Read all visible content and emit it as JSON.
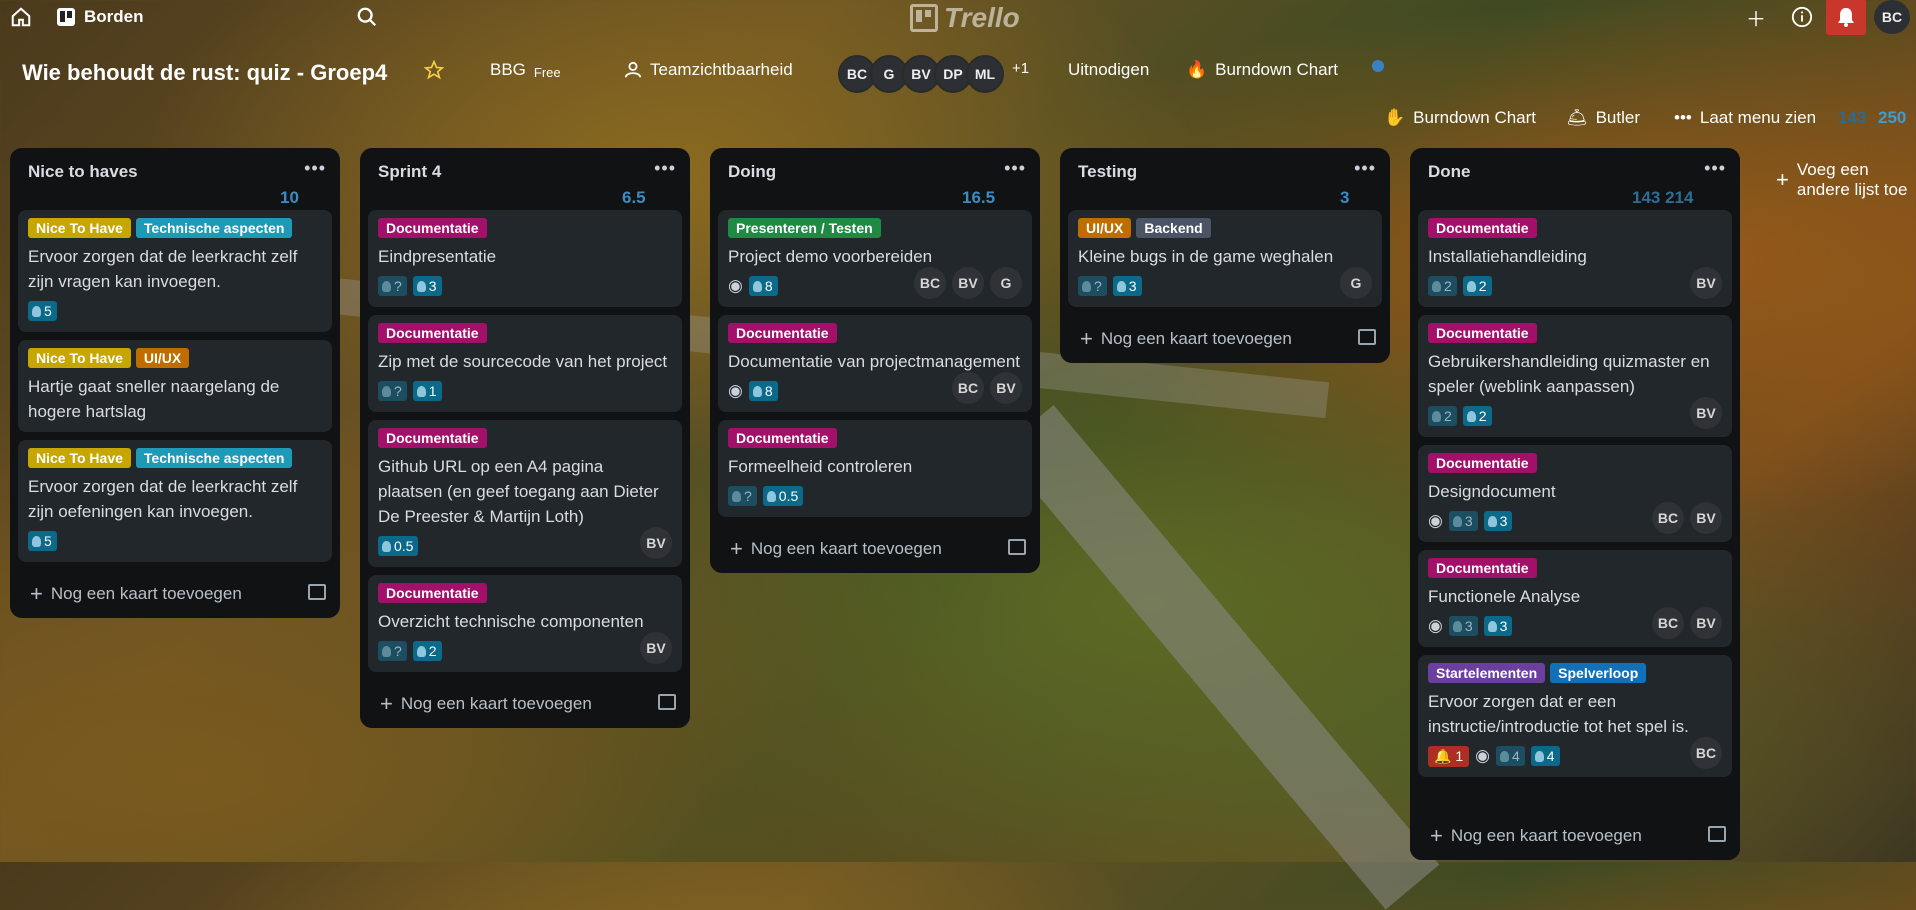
{
  "topbar": {
    "boards_label": "Borden",
    "brand": "Trello",
    "user_initials": "BC"
  },
  "board": {
    "title": "Wie behoudt de rust: quiz - Groep4",
    "workspace": "BBG",
    "plan": "Free",
    "visibility": "Teamzichtbaarheid",
    "members": [
      "BC",
      "G",
      "BV",
      "DP",
      "ML"
    ],
    "extra_members": "+1",
    "invite": "Uitnodigen",
    "burndown_top": "Burndown Chart",
    "burndown_2": "Burndown Chart",
    "butler": "Butler",
    "menu": "Laat menu zien",
    "total_a": "143",
    "total_b": "250",
    "add_list": "Voeg een andere lijst toe"
  },
  "lists": [
    {
      "title": "Nice to haves",
      "count": "10",
      "cards": [
        {
          "labels": [
            {
              "text": "Nice To Have",
              "color": "#c8a600"
            },
            {
              "text": "Technische aspecten",
              "color": "#1d9ab8"
            }
          ],
          "title": "Ervoor zorgen dat de leerkracht zelf zijn vragen kan invoegen.",
          "badges": [
            {
              "text": "5"
            }
          ],
          "eye": false,
          "avatars": []
        },
        {
          "labels": [
            {
              "text": "Nice To Have",
              "color": "#c8a600"
            },
            {
              "text": "UI/UX",
              "color": "#c06d00"
            }
          ],
          "title": "Hartje gaat sneller naargelang de hogere hartslag",
          "badges": [],
          "eye": false,
          "avatars": []
        },
        {
          "labels": [
            {
              "text": "Nice To Have",
              "color": "#c8a600"
            },
            {
              "text": "Technische aspecten",
              "color": "#1d9ab8"
            }
          ],
          "title": "Ervoor zorgen dat de leerkracht zelf zijn oefeningen kan invoegen.",
          "badges": [
            {
              "text": "5"
            }
          ],
          "eye": false,
          "avatars": []
        }
      ],
      "add": "Nog een kaart toevoegen"
    },
    {
      "title": "Sprint 4",
      "count": "6.5",
      "cards": [
        {
          "labels": [
            {
              "text": "Documentatie",
              "color": "#a3106a"
            }
          ],
          "title": "Eindpresentatie",
          "badges": [
            {
              "text": "?",
              "q": true
            },
            {
              "text": "3"
            }
          ],
          "eye": false,
          "avatars": []
        },
        {
          "labels": [
            {
              "text": "Documentatie",
              "color": "#a3106a"
            }
          ],
          "title": "Zip met de sourcecode van het project",
          "badges": [
            {
              "text": "?",
              "q": true
            },
            {
              "text": "1"
            }
          ],
          "eye": false,
          "avatars": []
        },
        {
          "labels": [
            {
              "text": "Documentatie",
              "color": "#a3106a"
            }
          ],
          "title": "Github URL op een A4 pagina plaatsen (en geef toegang aan Dieter De Preester & Martijn Loth)",
          "badges": [
            {
              "text": "0.5"
            }
          ],
          "eye": false,
          "avatars": [
            "BV"
          ]
        },
        {
          "labels": [
            {
              "text": "Documentatie",
              "color": "#a3106a"
            }
          ],
          "title": "Overzicht technische componenten",
          "badges": [
            {
              "text": "?",
              "q": true
            },
            {
              "text": "2"
            }
          ],
          "eye": false,
          "avatars": [
            "BV"
          ]
        }
      ],
      "add": "Nog een kaart toevoegen"
    },
    {
      "title": "Doing",
      "count": "16.5",
      "cards": [
        {
          "labels": [
            {
              "text": "Presenteren / Testen",
              "color": "#1f8a43"
            }
          ],
          "title": "Project demo voorbereiden",
          "badges": [
            {
              "text": "8"
            }
          ],
          "eye": true,
          "avatars": [
            "BC",
            "BV",
            "G"
          ]
        },
        {
          "labels": [
            {
              "text": "Documentatie",
              "color": "#a3106a"
            }
          ],
          "title": "Documentatie van projectmanagement",
          "badges": [
            {
              "text": "8"
            }
          ],
          "eye": true,
          "avatars": [
            "BC",
            "BV"
          ]
        },
        {
          "labels": [
            {
              "text": "Documentatie",
              "color": "#a3106a"
            }
          ],
          "title": "Formeelheid controleren",
          "badges": [
            {
              "text": "?",
              "q": true
            },
            {
              "text": "0.5"
            }
          ],
          "eye": false,
          "avatars": []
        }
      ],
      "add": "Nog een kaart toevoegen"
    },
    {
      "title": "Testing",
      "count": "3",
      "cards": [
        {
          "labels": [
            {
              "text": "UI/UX",
              "color": "#c06d00"
            },
            {
              "text": "Backend",
              "color": "#4a5464"
            }
          ],
          "title": "Kleine bugs in de game weghalen",
          "badges": [
            {
              "text": "?",
              "q": true
            },
            {
              "text": "3"
            }
          ],
          "eye": false,
          "avatars": [
            "G"
          ]
        }
      ],
      "add": "Nog een kaart toevoegen"
    },
    {
      "title": "Done",
      "count": "143 214",
      "cards": [
        {
          "labels": [
            {
              "text": "Documentatie",
              "color": "#a3106a"
            }
          ],
          "title": "Installatiehandleiding",
          "badges": [
            {
              "text": "2",
              "q": true
            },
            {
              "text": "2"
            }
          ],
          "eye": false,
          "avatars": [
            "BV"
          ]
        },
        {
          "labels": [
            {
              "text": "Documentatie",
              "color": "#a3106a"
            }
          ],
          "title": "Gebruikershandleiding quizmaster en speler (weblink aanpassen)",
          "badges": [
            {
              "text": "2",
              "q": true
            },
            {
              "text": "2"
            }
          ],
          "eye": false,
          "avatars": [
            "BV"
          ]
        },
        {
          "labels": [
            {
              "text": "Documentatie",
              "color": "#a3106a"
            }
          ],
          "title": "Designdocument",
          "badges": [
            {
              "text": "3",
              "q": true
            },
            {
              "text": "3"
            }
          ],
          "eye": true,
          "avatars": [
            "BC",
            "BV"
          ]
        },
        {
          "labels": [
            {
              "text": "Documentatie",
              "color": "#a3106a"
            }
          ],
          "title": "Functionele Analyse",
          "badges": [
            {
              "text": "3",
              "q": true
            },
            {
              "text": "3"
            }
          ],
          "eye": true,
          "avatars": [
            "BC",
            "BV"
          ]
        },
        {
          "labels": [
            {
              "text": "Startelementen",
              "color": "#6b3fa0"
            },
            {
              "text": "Spelverloop",
              "color": "#1170b8"
            }
          ],
          "title": "Ervoor zorgen dat er een instructie/introductie tot het spel is.",
          "alarm": "1",
          "badges": [
            {
              "text": "4",
              "q": true
            },
            {
              "text": "4"
            }
          ],
          "eye": true,
          "avatars": [
            "BC"
          ]
        }
      ],
      "add": "Nog een kaart toevoegen"
    }
  ]
}
